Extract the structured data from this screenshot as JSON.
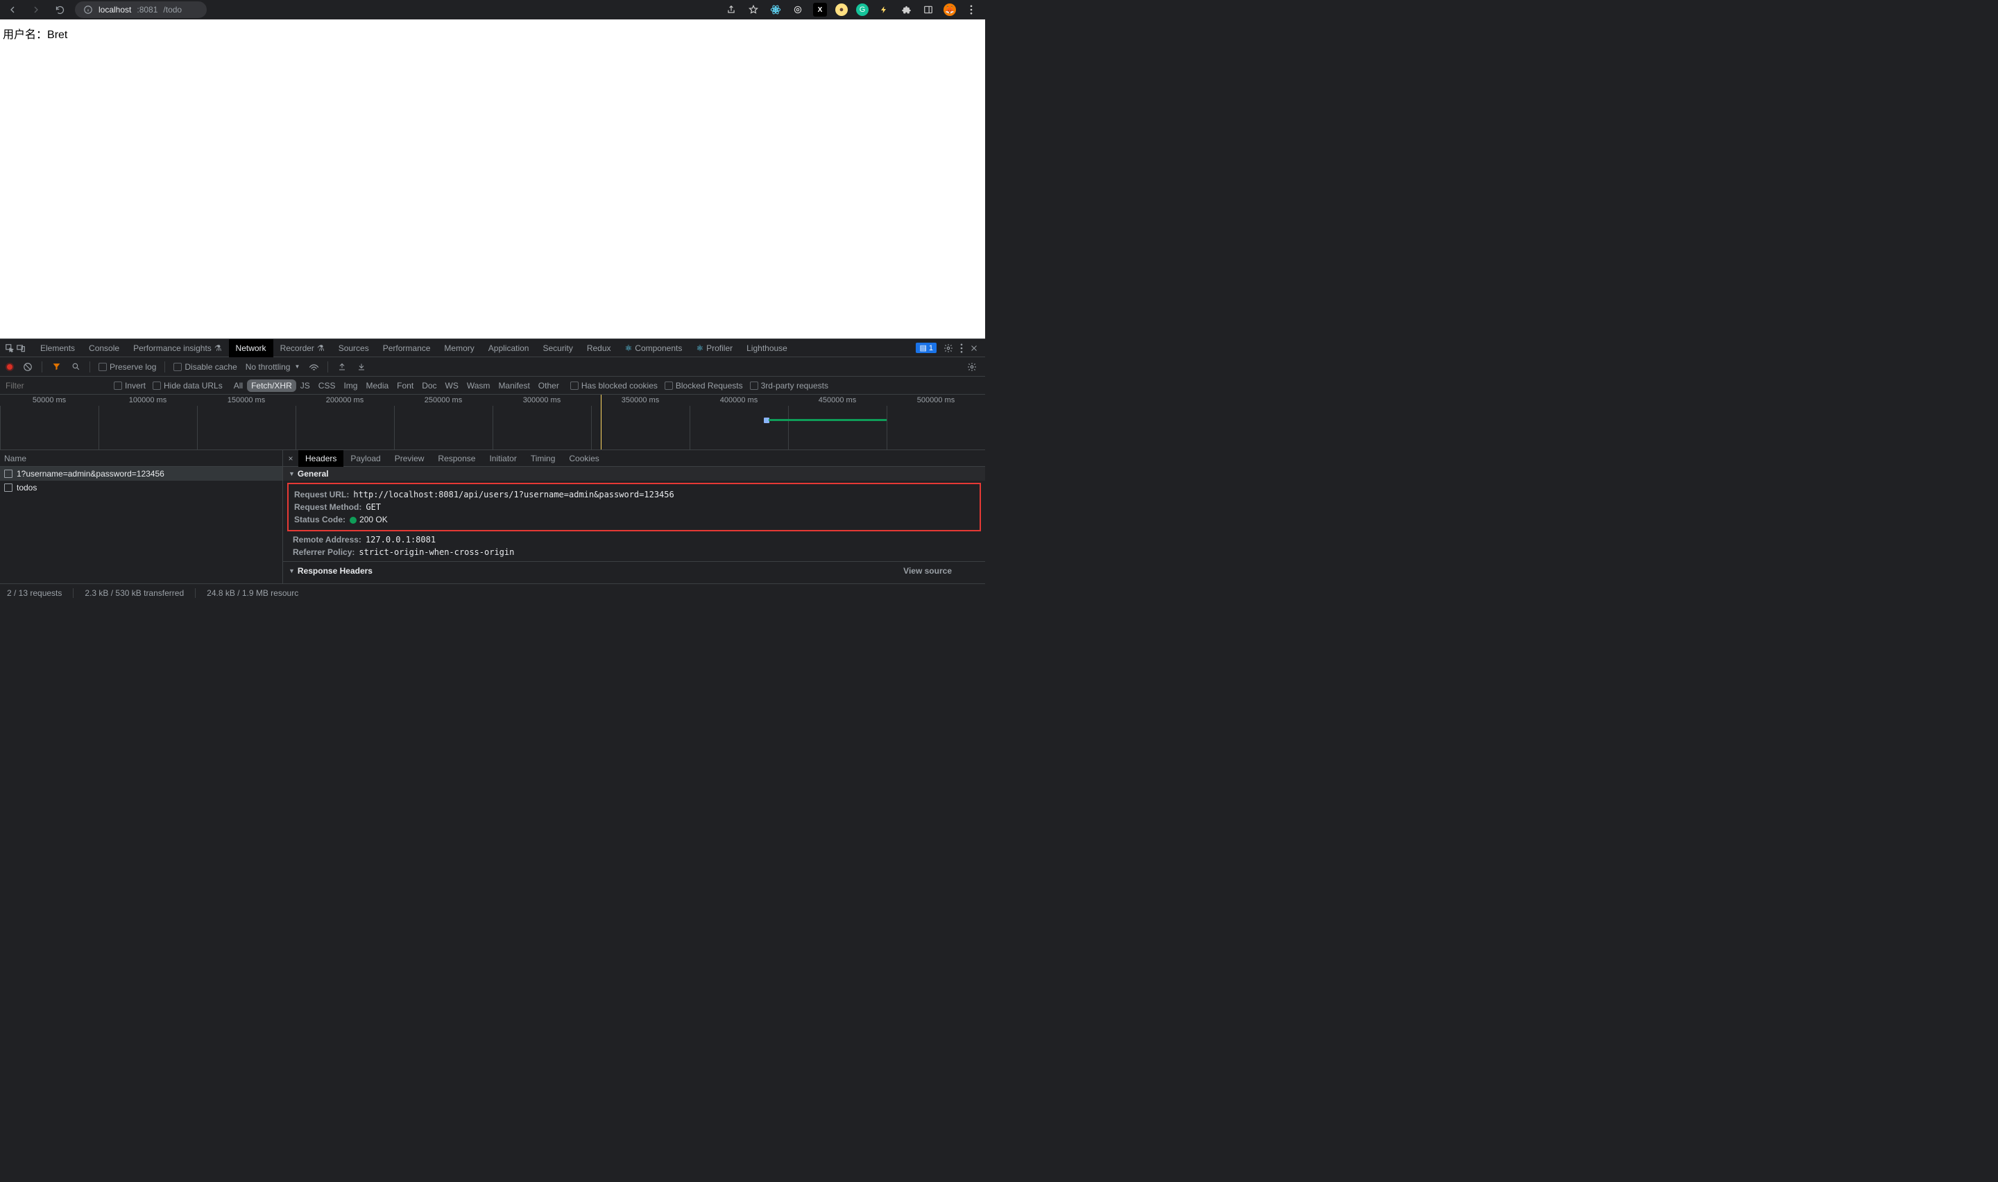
{
  "browser": {
    "url_host": "localhost",
    "url_port": ":8081",
    "url_path": "/todo"
  },
  "page": {
    "username_label": "用户名：",
    "username_value": "Bret"
  },
  "devtools": {
    "tabs": [
      "Elements",
      "Console",
      "Performance insights",
      "Network",
      "Recorder",
      "Sources",
      "Performance",
      "Memory",
      "Application",
      "Security",
      "Redux",
      "Components",
      "Profiler",
      "Lighthouse"
    ],
    "active_tab": "Network",
    "issues_badge": "1"
  },
  "net_toolbar": {
    "preserve_log": "Preserve log",
    "disable_cache": "Disable cache",
    "throttling": "No throttling"
  },
  "filter": {
    "placeholder": "Filter",
    "invert": "Invert",
    "hide_data_urls": "Hide data URLs",
    "types": [
      "All",
      "Fetch/XHR",
      "JS",
      "CSS",
      "Img",
      "Media",
      "Font",
      "Doc",
      "WS",
      "Wasm",
      "Manifest",
      "Other"
    ],
    "active_type": "Fetch/XHR",
    "has_blocked_cookies": "Has blocked cookies",
    "blocked_requests": "Blocked Requests",
    "third_party": "3rd-party requests"
  },
  "timeline": {
    "labels": [
      "50000 ms",
      "100000 ms",
      "150000 ms",
      "200000 ms",
      "250000 ms",
      "300000 ms",
      "350000 ms",
      "400000 ms",
      "450000 ms",
      "500000 ms"
    ]
  },
  "requests": {
    "header": "Name",
    "rows": [
      {
        "name": "1?username=admin&password=123456",
        "selected": true
      },
      {
        "name": "todos",
        "selected": false
      }
    ]
  },
  "detail": {
    "tabs": [
      "Headers",
      "Payload",
      "Preview",
      "Response",
      "Initiator",
      "Timing",
      "Cookies"
    ],
    "active": "Headers",
    "general_label": "General",
    "kv": {
      "request_url_key": "Request URL:",
      "request_url_val": "http://localhost:8081/api/users/1?username=admin&password=123456",
      "request_method_key": "Request Method:",
      "request_method_val": "GET",
      "status_code_key": "Status Code:",
      "status_code_val": "200 OK",
      "remote_addr_key": "Remote Address:",
      "remote_addr_val": "127.0.0.1:8081",
      "referrer_key": "Referrer Policy:",
      "referrer_val": "strict-origin-when-cross-origin"
    },
    "response_headers_label": "Response Headers",
    "view_source": "View source"
  },
  "status": {
    "requests": "2 / 13 requests",
    "transferred": "2.3 kB / 530 kB transferred",
    "resources": "24.8 kB / 1.9 MB resourc"
  }
}
